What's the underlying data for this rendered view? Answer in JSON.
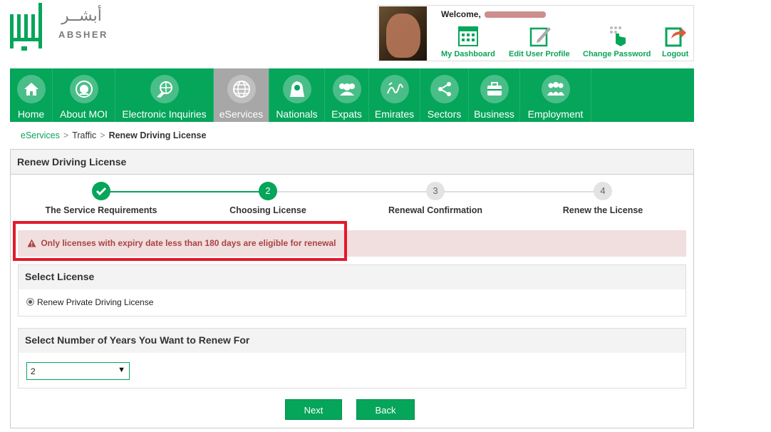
{
  "brand": {
    "name_en": "ABSHER",
    "name_ar": "أبشــر",
    "color": "#05a55a"
  },
  "user": {
    "welcome_label": "Welcome,",
    "links": [
      {
        "label": "My Dashboard",
        "icon": "dashboard-icon"
      },
      {
        "label": "Edit User Profile",
        "icon": "edit-profile-icon"
      },
      {
        "label": "Change Password",
        "icon": "change-password-icon"
      },
      {
        "label": "Logout",
        "icon": "logout-icon"
      }
    ]
  },
  "nav": [
    {
      "label": "Home",
      "icon": "home-icon"
    },
    {
      "label": "About MOI",
      "icon": "moi-emblem-icon"
    },
    {
      "label": "Electronic Inquiries",
      "icon": "globe-hand-icon"
    },
    {
      "label": "eServices",
      "icon": "globe-icon",
      "active": true
    },
    {
      "label": "Nationals",
      "icon": "national-person-icon"
    },
    {
      "label": "Expats",
      "icon": "people-group-icon"
    },
    {
      "label": "Emirates",
      "icon": "emirates-calligraphy-icon"
    },
    {
      "label": "Sectors",
      "icon": "share-nodes-icon"
    },
    {
      "label": "Business",
      "icon": "briefcase-icon"
    },
    {
      "label": "Employment",
      "icon": "employees-icon"
    }
  ],
  "breadcrumb": {
    "items": [
      "eServices",
      "Traffic"
    ],
    "current": "Renew Driving License"
  },
  "panel": {
    "title": "Renew Driving License"
  },
  "stepper": {
    "steps": [
      {
        "number": "✓",
        "label": "The Service Requirements",
        "state": "done"
      },
      {
        "number": "2",
        "label": "Choosing License",
        "state": "current"
      },
      {
        "number": "3",
        "label": "Renewal Confirmation",
        "state": "todo"
      },
      {
        "number": "4",
        "label": "Renew the License",
        "state": "todo"
      }
    ]
  },
  "alert": {
    "message": "Only licenses with expiry date less than 180 days are eligible for renewal",
    "icon": "warning-icon"
  },
  "select_license": {
    "title": "Select License",
    "option_label": "Renew Private Driving License"
  },
  "select_years": {
    "title": "Select Number of Years You Want to Renew For",
    "selected_value": "2"
  },
  "buttons": {
    "next": "Next",
    "back": "Back"
  }
}
